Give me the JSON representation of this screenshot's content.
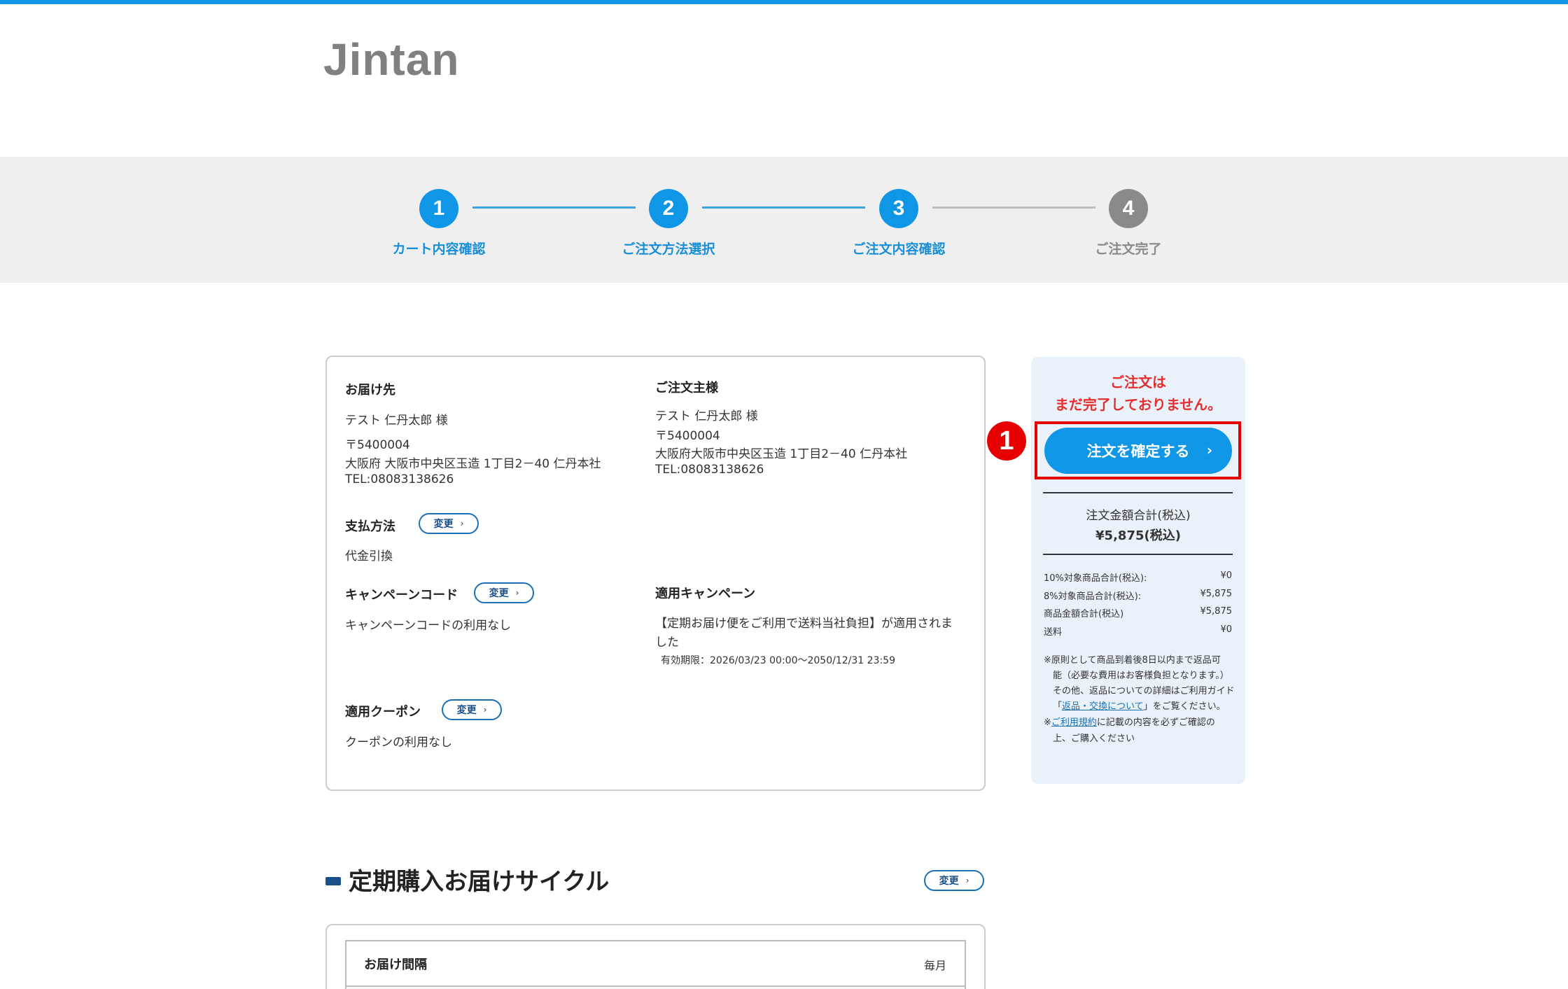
{
  "brand": {
    "logo_text": "Jintan"
  },
  "steps": [
    {
      "number": "1",
      "label": "カート内容確認",
      "state": "active"
    },
    {
      "number": "2",
      "label": "ご注文方法選択",
      "state": "active"
    },
    {
      "number": "3",
      "label": "ご注文内容確認",
      "state": "active"
    },
    {
      "number": "4",
      "label": "ご注文完了",
      "state": "inactive"
    }
  ],
  "delivery": {
    "heading": "お届け先",
    "name": "テスト 仁丹太郎 様",
    "postal": "〒5400004",
    "address": "大阪府 大阪市中央区玉造 1丁目2－40 仁丹本社",
    "tel": "TEL:08083138626"
  },
  "orderer": {
    "heading": "ご注文主様",
    "name": "テスト 仁丹太郎 様",
    "postal": "〒5400004",
    "address": "大阪府大阪市中央区玉造 1丁目2－40 仁丹本社",
    "tel": "TEL:08083138626"
  },
  "payment": {
    "heading": "支払方法",
    "value": "代金引換",
    "change_label": "変更"
  },
  "campaign_code": {
    "heading": "キャンペーンコード",
    "value": "キャンペーンコードの利用なし",
    "change_label": "変更"
  },
  "applied_campaign": {
    "heading": "適用キャンペーン",
    "line1": "【定期お届け便をご利用で送料当社負担】が適用されま",
    "line2": "した",
    "validity": "有効期限：2026/03/23 00:00～2050/12/31 23:59"
  },
  "coupon": {
    "heading": "適用クーポン",
    "value": "クーポンの利用なし",
    "change_label": "変更"
  },
  "sidebar": {
    "warning_line1": "ご注文は",
    "warning_line2": "まだ完了しておりません。",
    "confirm_label": "注文を確定する",
    "marker": "1",
    "total_label": "注文金額合計(税込)",
    "total_value": "¥5,875(税込)",
    "breakdown": [
      {
        "label": "10%対象商品合計(税込):",
        "value": "¥0"
      },
      {
        "label": "8%対象商品合計(税込):",
        "value": "¥5,875"
      },
      {
        "label": "商品金額合計(税込)",
        "value": "¥5,875"
      },
      {
        "label": "送料",
        "value": "¥0"
      }
    ],
    "note1_a": "※原則として商品到着後8日以内まで返品可",
    "note1_b": "能（必要な費用はお客様負担となります。）",
    "note1_c": "その他、返品についての詳細はご利用ガイド",
    "note1_d_prefix": "「",
    "note1_d_link": "返品・交換について",
    "note1_d_suffix": "」をご覧ください。",
    "note2_prefix": "※",
    "note2_link": "ご利用規約",
    "note2_suffix": "に記載の内容を必ずご確認の",
    "note2_b": "上、ご購入ください"
  },
  "cycle": {
    "title": "定期購入お届けサイクル",
    "change_label": "変更",
    "interval_label": "お届け間隔",
    "interval_value": "毎月"
  },
  "colors": {
    "accent": "#0f96e6",
    "warning": "#e62e2e",
    "highlight_frame": "#e60000",
    "panel_bg": "#e9f2fa"
  }
}
